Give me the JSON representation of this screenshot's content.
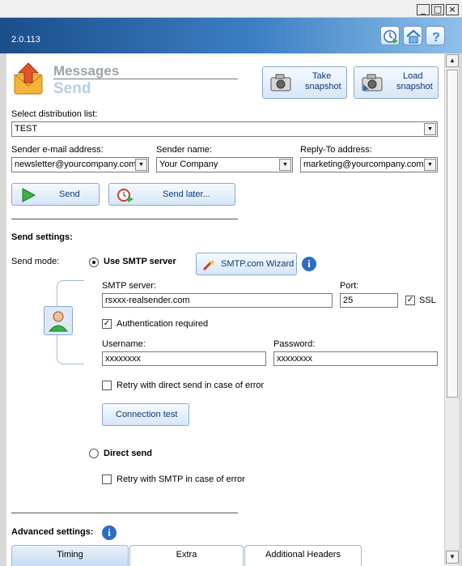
{
  "app": {
    "version": "2.0.113"
  },
  "page": {
    "title": "Messages",
    "subtitle": "Send"
  },
  "snapshot": {
    "take_label_1": "Take",
    "take_label_2": "snapshot",
    "load_label_1": "Load",
    "load_label_2": "snapshot"
  },
  "distribution": {
    "label": "Select distribution list:",
    "value": "TEST"
  },
  "sender": {
    "email_label": "Sender e-mail address:",
    "email_value": "newsletter@yourcompany.com",
    "name_label": "Sender name:",
    "name_value": "Your Company",
    "reply_label": "Reply-To address:",
    "reply_value": "marketing@yourcompany.com"
  },
  "actions": {
    "send": "Send",
    "send_later": "Send later..."
  },
  "send_settings": {
    "heading": "Send settings:",
    "mode_label": "Send mode:",
    "smtp_option": "Use SMTP server",
    "wizard_button": "SMTP.com Wizard",
    "server_label": "SMTP server:",
    "server_value": "rsxxx-realsender.com",
    "port_label": "Port:",
    "port_value": "25",
    "ssl_label": "SSL",
    "auth_label": "Authentication required",
    "username_label": "Username:",
    "username_value": "xxxxxxxx",
    "password_label": "Password:",
    "password_value": "xxxxxxxx",
    "retry_direct_label": "Retry with direct send in case of error",
    "connection_test": "Connection test",
    "direct_option": "Direct send",
    "retry_smtp_label": "Retry with SMTP in case of error"
  },
  "advanced": {
    "heading": "Advanced settings:",
    "tabs": [
      {
        "label": "Timing"
      },
      {
        "label": "Extra"
      },
      {
        "label": "Additional Headers"
      }
    ]
  },
  "state": {
    "smtp_selected": true,
    "ssl_checked": true,
    "auth_checked": true,
    "retry_direct_checked": false,
    "retry_smtp_checked": false
  },
  "colors": {
    "header_dark": "#1b4d8a",
    "accent": "#2a6dc4",
    "send_green": "#3cb043"
  }
}
